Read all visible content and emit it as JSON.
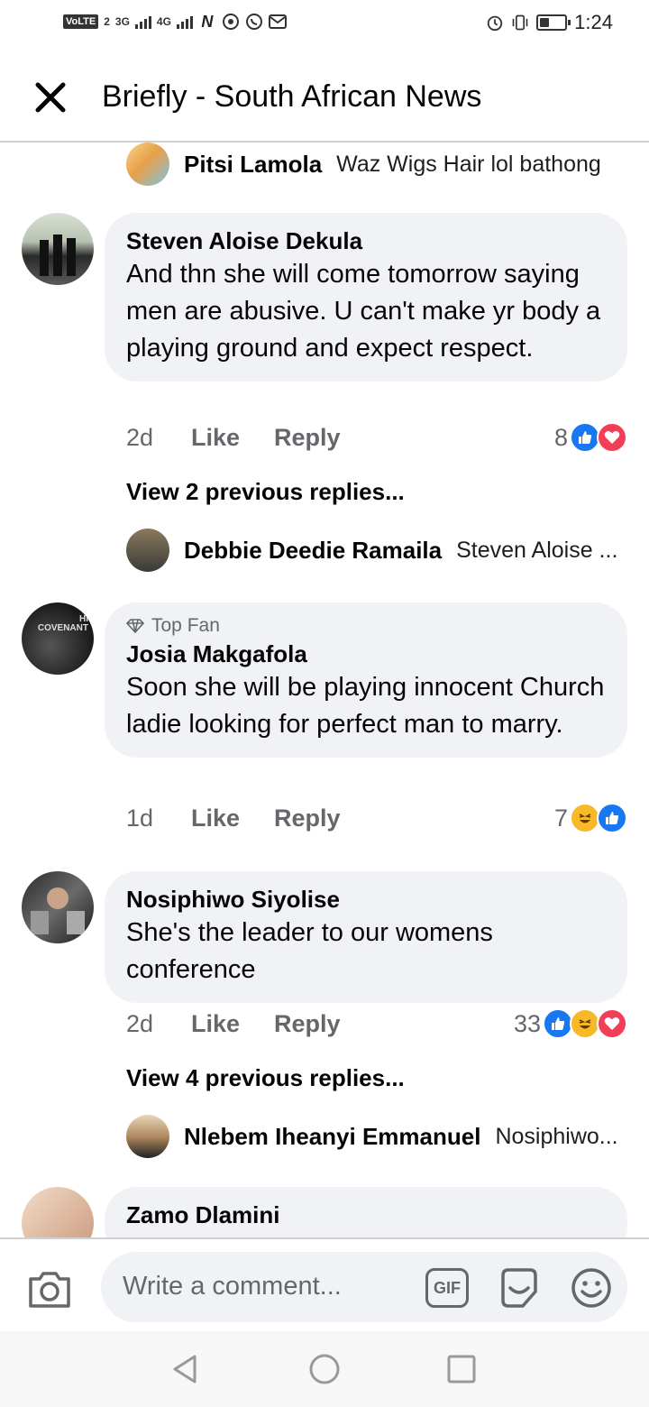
{
  "status_bar": {
    "volte": "VoLTE",
    "sim": "2",
    "net1": "3G",
    "net2": "4G",
    "time": "1:24",
    "battery_level": 0.4
  },
  "header": {
    "title": "Briefly - South African News",
    "close_icon": "close-icon"
  },
  "top_reply": {
    "name": "Pitsi Lamola",
    "text": "Waz Wigs Hair lol bathong"
  },
  "comments": [
    {
      "name": "Steven Aloise Dekula",
      "badge": "",
      "text": "And thn she will come tomorrow saying men are abusive. U can't make yr body a playing ground and expect respect.",
      "time": "2d",
      "like_label": "Like",
      "reply_label": "Reply",
      "reaction_count": "8",
      "reactions": [
        "like",
        "love"
      ],
      "view_more": "View 2 previous replies...",
      "preview_reply": {
        "name": "Debbie Deedie Ramaila",
        "text": "Steven Aloise ..."
      }
    },
    {
      "name": "Josia Makgafola",
      "badge": "Top Fan",
      "text": "Soon she will be playing innocent Church ladie looking for perfect man to marry.",
      "time": "1d",
      "like_label": "Like",
      "reply_label": "Reply",
      "reaction_count": "7",
      "reactions": [
        "haha",
        "like"
      ],
      "avatar_text": "HI COVENANT"
    },
    {
      "name": "Nosiphiwo Siyolise",
      "badge": "",
      "text": "She's the leader to our womens conference",
      "time": "2d",
      "like_label": "Like",
      "reply_label": "Reply",
      "reaction_count": "33",
      "reactions": [
        "like",
        "haha",
        "love"
      ],
      "view_more": "View 4 previous replies...",
      "preview_reply": {
        "name": "Nlebem Iheanyi Emmanuel",
        "text": "Nosiphiwo..."
      }
    },
    {
      "name": "Zamo Dlamini"
    }
  ],
  "composer": {
    "placeholder": "Write a comment...",
    "gif_label": "GIF"
  },
  "colors": {
    "bubble": "#f0f2f5",
    "secondary_text": "#65676b",
    "like_blue": "#1877f2",
    "love_red": "#f33e58",
    "haha_yellow": "#f7b928"
  }
}
